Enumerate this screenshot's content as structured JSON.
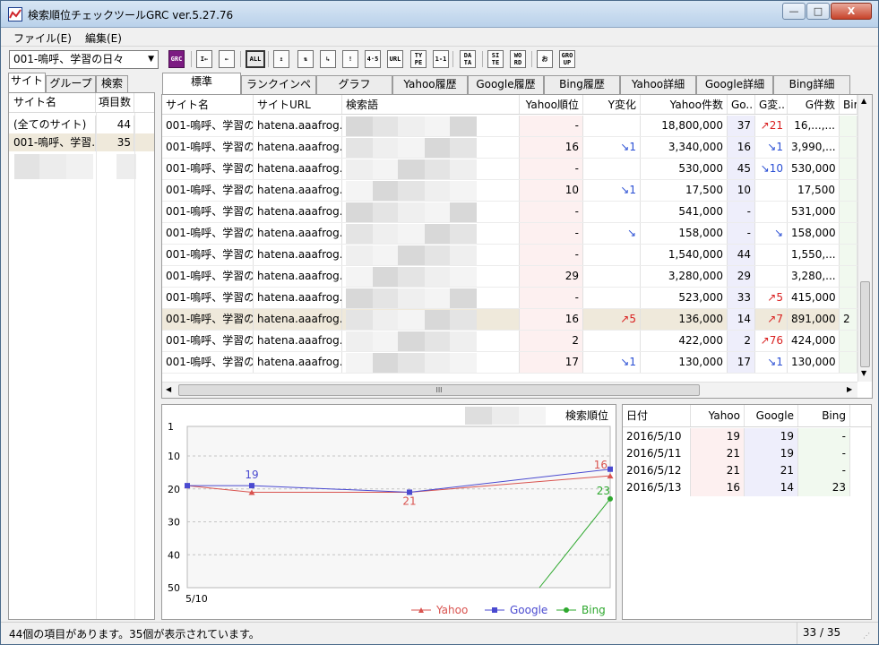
{
  "window": {
    "title": "検索順位チェックツールGRC  ver.5.27.76",
    "min_label": "—",
    "max_label": "□",
    "close_label": "X"
  },
  "menu": {
    "file": "ファイル(E)",
    "edit": "編集(E)"
  },
  "toolbar": {
    "site_combo": "001-嗚呼、学習の日々",
    "buttons": [
      {
        "name": "grc",
        "label": "GRC"
      },
      {
        "name": "first",
        "label": "I←"
      },
      {
        "name": "back",
        "label": "←"
      },
      {
        "name": "all",
        "label": "ALL"
      },
      {
        "name": "up",
        "label": "↥"
      },
      {
        "name": "updown",
        "label": "⇅"
      },
      {
        "name": "down",
        "label": "↳"
      },
      {
        "name": "exclaim",
        "label": "!"
      },
      {
        "name": "45",
        "label": "4·5"
      },
      {
        "name": "url",
        "label": "URL"
      },
      {
        "name": "type",
        "label": "TY PE"
      },
      {
        "name": "oneone",
        "label": "1-1"
      },
      {
        "name": "data",
        "label": "DA TA"
      },
      {
        "name": "site",
        "label": "SI TE"
      },
      {
        "name": "word",
        "label": "WO RD"
      },
      {
        "name": "o",
        "label": "お"
      },
      {
        "name": "group",
        "label": "GRO UP"
      }
    ]
  },
  "left": {
    "tabs": [
      "サイト",
      "グループ",
      "検索"
    ],
    "headers": {
      "name": "サイト名",
      "count": "項目数"
    },
    "rows": [
      {
        "name": "(全てのサイト)",
        "count": "44"
      },
      {
        "name": "001-嗚呼、学習...",
        "count": "35"
      }
    ]
  },
  "main": {
    "tabs": [
      "標準",
      "ランクインページ",
      "グラフ",
      "Yahoo履歴",
      "Google履歴",
      "Bing履歴",
      "Yahoo詳細",
      "Google詳細",
      "Bing詳細"
    ],
    "headers": {
      "site": "サイト名",
      "url": "サイトURL",
      "keyword": "検索語",
      "yrank": "Yahoo順位",
      "ychange": "Y変化",
      "ycount": "Yahoo件数",
      "go": "Go..",
      "gchange": "G変..",
      "gcount": "G件数",
      "bi": "Bir"
    },
    "rows": [
      {
        "site": "001-嗚呼、学習の",
        "url": "hatena.aaafrog.",
        "yrank": "-",
        "ych": "",
        "ycount": "18,800,000",
        "go": "37",
        "gch": "↗21",
        "gcount": "16,...,..."
      },
      {
        "site": "001-嗚呼、学習の",
        "url": "hatena.aaafrog.",
        "yrank": "16",
        "ych": "↘1",
        "ycount": "3,340,000",
        "go": "16",
        "gch": "↘1",
        "gcount": "3,990,..."
      },
      {
        "site": "001-嗚呼、学習の",
        "url": "hatena.aaafrog.",
        "yrank": "-",
        "ych": "",
        "ycount": "530,000",
        "go": "45",
        "gch": "↘10",
        "gcount": "530,000"
      },
      {
        "site": "001-嗚呼、学習の",
        "url": "hatena.aaafrog.",
        "yrank": "10",
        "ych": "↘1",
        "ycount": "17,500",
        "go": "10",
        "gch": "",
        "gcount": "17,500"
      },
      {
        "site": "001-嗚呼、学習の",
        "url": "hatena.aaafrog.",
        "yrank": "-",
        "ych": "",
        "ycount": "541,000",
        "go": "-",
        "gch": "",
        "gcount": "531,000"
      },
      {
        "site": "001-嗚呼、学習の",
        "url": "hatena.aaafrog.",
        "yrank": "-",
        "ych": "↘",
        "ycount": "158,000",
        "go": "-",
        "gch": "↘",
        "gcount": "158,000"
      },
      {
        "site": "001-嗚呼、学習の",
        "url": "hatena.aaafrog.",
        "yrank": "-",
        "ych": "",
        "ycount": "1,540,000",
        "go": "44",
        "gch": "",
        "gcount": "1,550,..."
      },
      {
        "site": "001-嗚呼、学習の",
        "url": "hatena.aaafrog.",
        "yrank": "29",
        "ych": "",
        "ycount": "3,280,000",
        "go": "29",
        "gch": "",
        "gcount": "3,280,..."
      },
      {
        "site": "001-嗚呼、学習の",
        "url": "hatena.aaafrog.",
        "yrank": "-",
        "ych": "",
        "ycount": "523,000",
        "go": "33",
        "gch": "↗5",
        "gcount": "415,000"
      },
      {
        "site": "001-嗚呼、学習の",
        "url": "hatena.aaafrog.",
        "yrank": "16",
        "ych": "↗5",
        "ycount": "136,000",
        "go": "14",
        "gch": "↗7",
        "gcount": "891,000",
        "bi": "2"
      },
      {
        "site": "001-嗚呼、学習の",
        "url": "hatena.aaafrog.",
        "yrank": "2",
        "ych": "",
        "ycount": "422,000",
        "go": "2",
        "gch": "↗76",
        "gcount": "424,000"
      },
      {
        "site": "001-嗚呼、学習の",
        "url": "hatena.aaafrog.",
        "yrank": "17",
        "ych": "↘1",
        "ycount": "130,000",
        "go": "17",
        "gch": "↘1",
        "gcount": "130,000"
      }
    ],
    "selected_row": 9,
    "scroll_label": "III"
  },
  "chart_data": {
    "type": "line",
    "title": "検索順位",
    "x_first_label": "5/10",
    "categories": [
      "2016/5/10",
      "2016/5/11",
      "2016/5/12",
      "2016/5/13"
    ],
    "ylim": [
      1,
      50
    ],
    "y_inverted": true,
    "yticks": [
      "1",
      "10",
      "20",
      "30",
      "40",
      "50"
    ],
    "series": [
      {
        "name": "Yahoo",
        "color": "#d9534f",
        "values": [
          19,
          21,
          21,
          16
        ]
      },
      {
        "name": "Google",
        "color": "#4a4ad0",
        "values": [
          19,
          19,
          21,
          14
        ]
      },
      {
        "name": "Bing",
        "color": "#2ea82e",
        "values": [
          null,
          null,
          null,
          23
        ]
      }
    ],
    "labels": [
      {
        "series": "Google",
        "index": 1,
        "text": "19"
      },
      {
        "series": "Yahoo",
        "index": 2,
        "text": "21"
      },
      {
        "series": "Yahoo",
        "index": 3,
        "text": "16"
      },
      {
        "series": "Bing",
        "index": 3,
        "text": "23"
      }
    ],
    "grid": true,
    "legend": "bottom-right"
  },
  "detail": {
    "headers": {
      "date": "日付",
      "yahoo": "Yahoo",
      "google": "Google",
      "bing": "Bing"
    },
    "rows": [
      {
        "date": "2016/5/10",
        "yahoo": "19",
        "google": "19",
        "bing": "-"
      },
      {
        "date": "2016/5/11",
        "yahoo": "21",
        "google": "19",
        "bing": "-"
      },
      {
        "date": "2016/5/12",
        "yahoo": "21",
        "google": "21",
        "bing": "-"
      },
      {
        "date": "2016/5/13",
        "yahoo": "16",
        "google": "14",
        "bing": "23"
      }
    ]
  },
  "status": {
    "message": "44個の項目があります。35個が表示されています。",
    "page": "33 / 35"
  }
}
